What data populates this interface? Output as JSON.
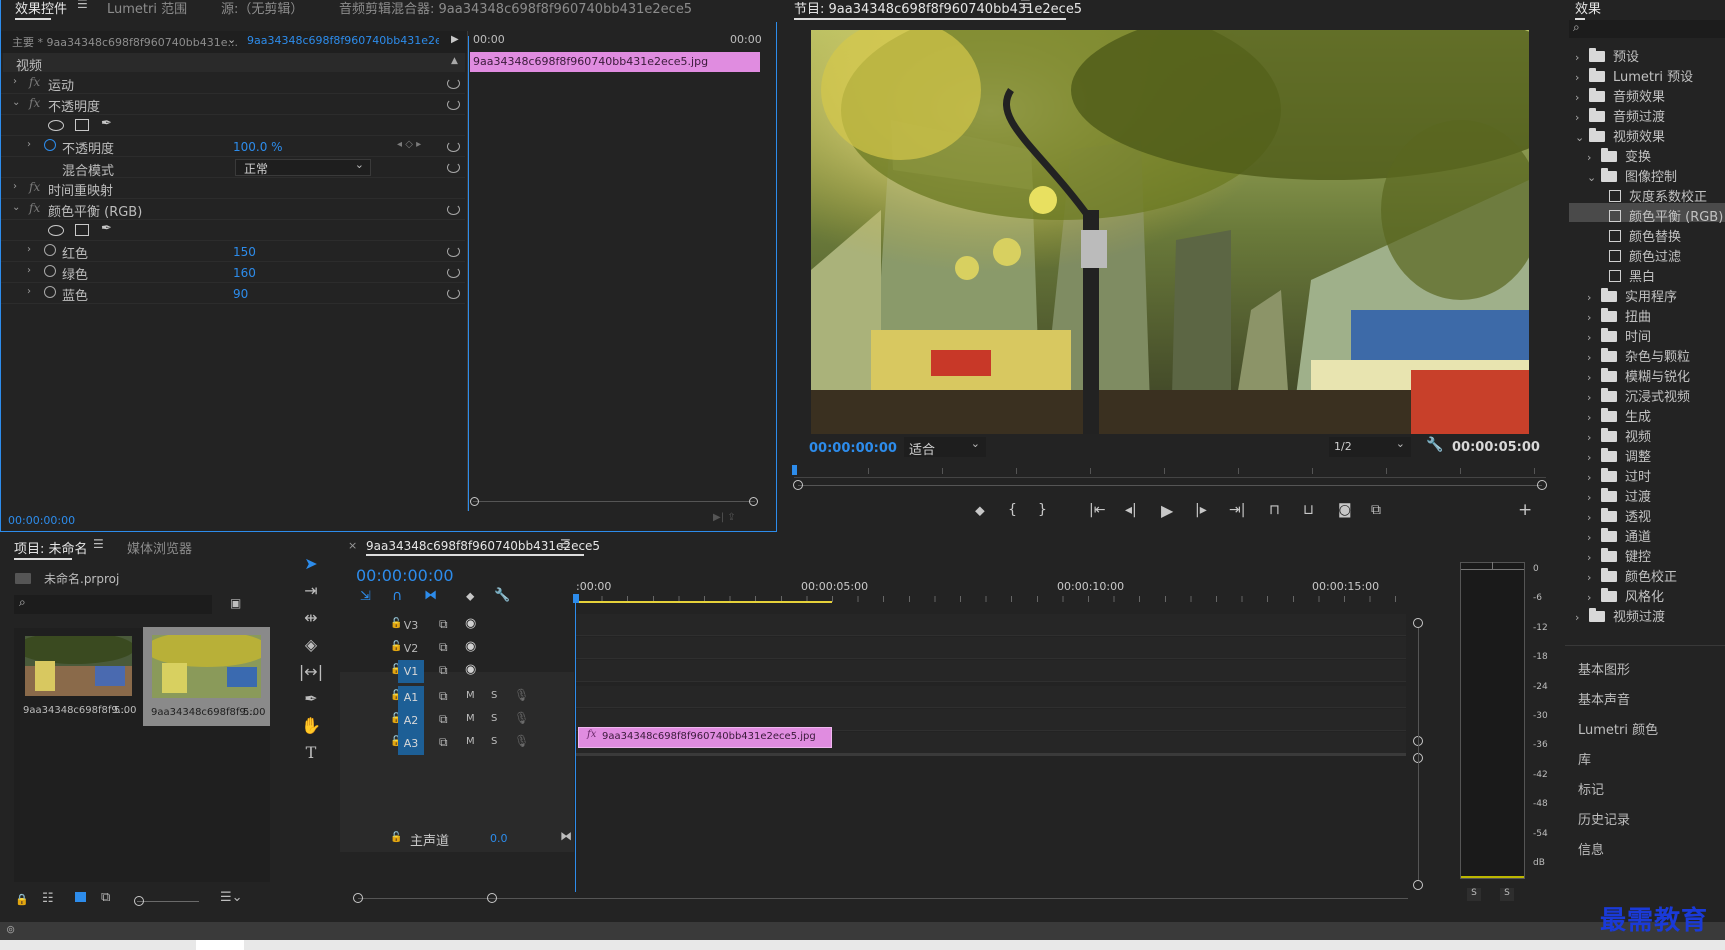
{
  "effect_controls": {
    "tabs": [
      "效果控件",
      "Lumetri 范围",
      "源:（无剪辑）",
      "音频剪辑混合器: 9aa34348c698f8f960740bb431e2ece5"
    ],
    "master_label": "主要 * 9aa34348c698f8f960740bb431e...",
    "sequence_label": "9aa34348c698f8f960740bb431e2ece5...",
    "section": "视频",
    "time_start": "00:00",
    "time_end": "00:00",
    "clip_name": "9aa34348c698f8f960740bb431e2ece5.jpg",
    "rows": [
      {
        "label": "运动"
      },
      {
        "label": "不透明度"
      },
      {
        "label": "不透明度",
        "value": "100.0 %"
      },
      {
        "label": "混合模式",
        "value": "正常"
      },
      {
        "label": "时间重映射"
      },
      {
        "label": "颜色平衡 (RGB)"
      },
      {
        "label": "红色",
        "value": "150"
      },
      {
        "label": "绿色",
        "value": "160"
      },
      {
        "label": "蓝色",
        "value": "90"
      }
    ],
    "timecode": "00:00:00:00"
  },
  "program": {
    "title": "节目: 9aa34348c698f8f960740bb431e2ece5",
    "timecode_left": "00:00:00:00",
    "fit": "适合",
    "resolution": "1/2",
    "timecode_right": "00:00:05:00"
  },
  "effects": {
    "title": "效果",
    "items": [
      {
        "label": "预设",
        "level": 0,
        "open": false
      },
      {
        "label": "Lumetri 预设",
        "level": 0,
        "open": false
      },
      {
        "label": "音频效果",
        "level": 0,
        "open": false
      },
      {
        "label": "音频过渡",
        "level": 0,
        "open": false
      },
      {
        "label": "视频效果",
        "level": 0,
        "open": true
      },
      {
        "label": "变换",
        "level": 1,
        "open": false
      },
      {
        "label": "图像控制",
        "level": 1,
        "open": true
      },
      {
        "label": "灰度系数校正",
        "level": 2
      },
      {
        "label": "颜色平衡 (RGB)",
        "level": 2,
        "selected": true
      },
      {
        "label": "颜色替换",
        "level": 2
      },
      {
        "label": "颜色过滤",
        "level": 2
      },
      {
        "label": "黑白",
        "level": 2
      },
      {
        "label": "实用程序",
        "level": 1,
        "open": false
      },
      {
        "label": "扭曲",
        "level": 1,
        "open": false
      },
      {
        "label": "时间",
        "level": 1,
        "open": false
      },
      {
        "label": "杂色与颗粒",
        "level": 1,
        "open": false
      },
      {
        "label": "模糊与锐化",
        "level": 1,
        "open": false
      },
      {
        "label": "沉浸式视频",
        "level": 1,
        "open": false
      },
      {
        "label": "生成",
        "level": 1,
        "open": false
      },
      {
        "label": "视频",
        "level": 1,
        "open": false
      },
      {
        "label": "调整",
        "level": 1,
        "open": false
      },
      {
        "label": "过时",
        "level": 1,
        "open": false
      },
      {
        "label": "过渡",
        "level": 1,
        "open": false
      },
      {
        "label": "透视",
        "level": 1,
        "open": false
      },
      {
        "label": "通道",
        "level": 1,
        "open": false
      },
      {
        "label": "键控",
        "level": 1,
        "open": false
      },
      {
        "label": "颜色校正",
        "level": 1,
        "open": false
      },
      {
        "label": "风格化",
        "level": 1,
        "open": false
      },
      {
        "label": "视频过渡",
        "level": 0,
        "open": false
      }
    ],
    "panels": [
      "基本图形",
      "基本声音",
      "Lumetri 颜色",
      "库",
      "标记",
      "历史记录",
      "信息"
    ]
  },
  "project": {
    "tabs": [
      "项目: 未命名",
      "媒体浏览器"
    ],
    "file": "未命名.prproj",
    "items": [
      {
        "name": "9aa34348c698f8f9...",
        "dur": "5:00"
      },
      {
        "name": "9aa34348c698f8f9...",
        "dur": "5:00"
      }
    ]
  },
  "timeline": {
    "seq_name": "9aa34348c698f8f960740bb431e2ece5",
    "timecode": "00:00:00:00",
    "ruler": [
      ":00:00",
      "00:00:05:00",
      "00:00:10:00",
      "00:00:15:00"
    ],
    "video_tracks": [
      "V3",
      "V2",
      "V1"
    ],
    "audio_tracks": [
      "A1",
      "A2",
      "A3"
    ],
    "master": "主声道",
    "master_val": "0.0",
    "clip": "9aa34348c698f8f960740bb431e2ece5.jpg",
    "m": "M",
    "s": "S"
  },
  "meter": {
    "scale": [
      "0",
      "-6",
      "-12",
      "-18",
      "-24",
      "-30",
      "-36",
      "-42",
      "-48",
      "-54",
      "dB"
    ],
    "solo": [
      "S",
      "S"
    ]
  },
  "watermark": "最需教育"
}
